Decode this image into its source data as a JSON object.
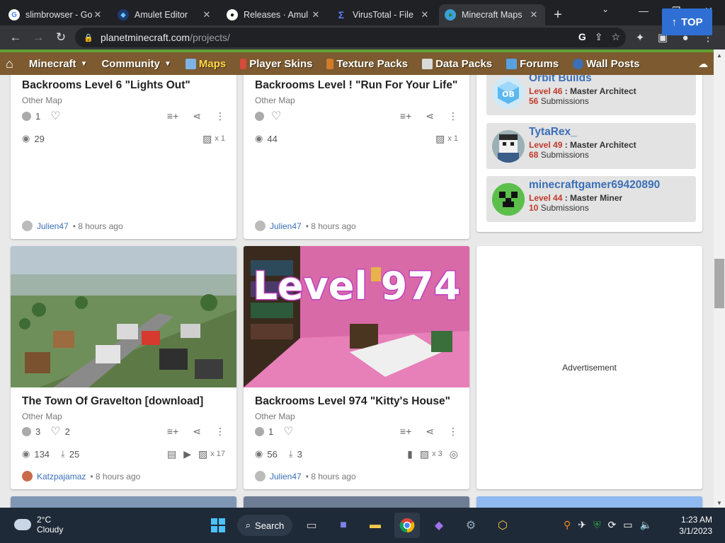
{
  "browser": {
    "tabs": [
      {
        "title": "slimbrowser - Go",
        "fav_color": "#ffffff",
        "fav_glyph": "G"
      },
      {
        "title": "Amulet Editor",
        "fav_color": "#2a6fd6",
        "fav_glyph": "◆"
      },
      {
        "title": "Releases · Amul",
        "fav_color": "#ffffff",
        "fav_glyph": "●"
      },
      {
        "title": "VirusTotal - File",
        "fav_color": "#3b5bdb",
        "fav_glyph": "Σ"
      },
      {
        "title": "Minecraft Maps",
        "fav_color": "#3aa0d8",
        "fav_glyph": "●",
        "active": true
      }
    ],
    "new_tab": "+",
    "url_host": "planetminecraft.com",
    "url_path": "/projects/"
  },
  "sitenav": {
    "items": [
      {
        "label": "Minecraft",
        "caret": true
      },
      {
        "label": "Community",
        "caret": true
      },
      {
        "label": "Maps",
        "active": true,
        "icon_color": "#7fb2e5"
      },
      {
        "label": "Player Skins",
        "icon_color": "#d64b3b"
      },
      {
        "label": "Texture Packs",
        "icon_color": "#d07b2a"
      },
      {
        "label": "Data Packs",
        "icon_color": "#d9d9d9"
      },
      {
        "label": "Forums",
        "icon_color": "#5aa0e0"
      },
      {
        "label": "Wall Posts",
        "icon_color": "#3b6fb7"
      }
    ]
  },
  "cards": {
    "c1": {
      "title": "Backrooms Level 6 \"Lights Out\"",
      "category": "Other Map",
      "diamonds": "1",
      "hearts": "",
      "views": "29",
      "images": "x 1",
      "author": "Julien47",
      "time": "8 hours ago"
    },
    "c2": {
      "title": "Backrooms Level ! \"Run For Your Life\"",
      "category": "Other Map",
      "diamonds": "",
      "hearts": "",
      "views": "44",
      "images": "x 1",
      "author": "Julien47",
      "time": "8 hours ago"
    },
    "c3": {
      "title": "The Town Of Gravelton [download]",
      "category": "Other Map",
      "diamonds": "3",
      "hearts": "2",
      "views": "134",
      "downloads": "25",
      "images": "x 17",
      "author": "Katzpajamaz",
      "time": "8 hours ago"
    },
    "c4": {
      "title": "Backrooms Level 974 \"Kitty's House\"",
      "category": "Other Map",
      "diamonds": "1",
      "hearts": "",
      "views": "56",
      "downloads": "3",
      "images": "x 3",
      "author": "Julien47",
      "time": "8 hours ago",
      "thumb_text": "Level 974"
    }
  },
  "members": [
    {
      "name": "Orbit Builds",
      "level": "Level 46",
      "rank": "Master Architect",
      "submissions": "56",
      "sub_label": "Submissions"
    },
    {
      "name": "TytaRex_",
      "level": "Level 49",
      "rank": "Master Architect",
      "submissions": "68",
      "sub_label": "Submissions"
    },
    {
      "name": "minecraftgamer69420890",
      "level": "Level 44",
      "rank": "Master Miner",
      "submissions": "10",
      "sub_label": "Submissions"
    }
  ],
  "top_button": "TOP",
  "advertisement": "Advertisement",
  "taskbar": {
    "temp": "2°C",
    "weather": "Cloudy",
    "search": "Search",
    "time": "1:23 AM",
    "date": "3/1/2023"
  }
}
